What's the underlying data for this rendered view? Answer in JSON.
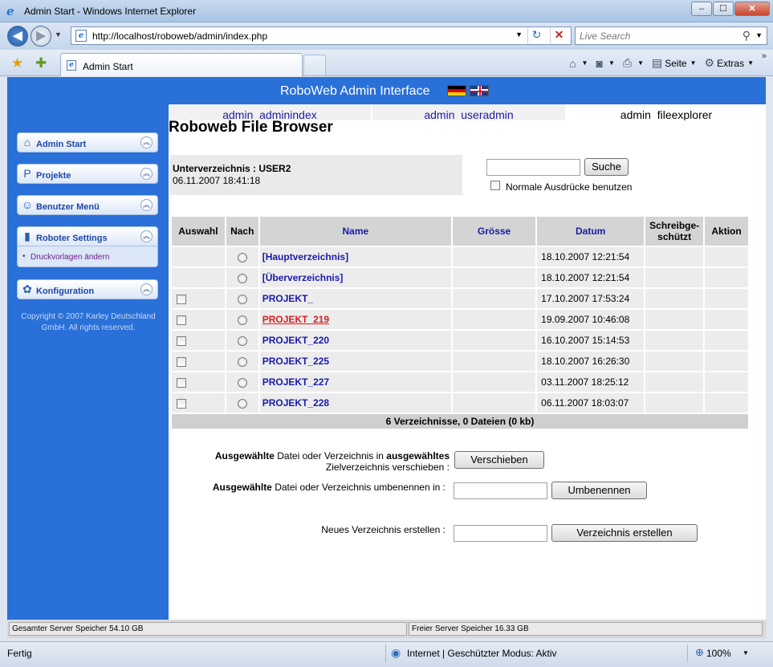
{
  "window": {
    "title": "Admin Start - Windows Internet Explorer",
    "min": "–",
    "max": "☐",
    "close": "✕"
  },
  "address_bar": {
    "url": "http://localhost/roboweb/admin/index.php",
    "search_placeholder": "Live Search"
  },
  "tabbar": {
    "tab_label": "Admin Start",
    "cmd_home": "⌂",
    "cmd_feeds": "◙",
    "cmd_print": "⎙",
    "cmd_page_label": "Seite",
    "cmd_tools_label": "Extras"
  },
  "header": {
    "title": "RoboWeb Admin Interface"
  },
  "sidebar": {
    "items": [
      {
        "label": "Admin Start",
        "icon": "⌂"
      },
      {
        "label": "Projekte",
        "icon": "P"
      },
      {
        "label": "Benutzer Menü",
        "icon": "☺"
      },
      {
        "label": "Roboter Settings",
        "icon": "▮"
      },
      {
        "label": "Konfiguration",
        "icon": "✿"
      }
    ],
    "sub_item": "Druckvorlagen ändern",
    "copyright": "Copyright © 2007 Karley Deutschland GmbH. All rights reserved."
  },
  "nav_tabs": [
    {
      "label": "admin_adminindex"
    },
    {
      "label": "admin_useradmin"
    },
    {
      "label": "admin_fileexplorer"
    }
  ],
  "page_title": "Roboweb File Browser",
  "directory": {
    "label": "Unterverzeichnis : USER2",
    "date": "06.11.2007 18:41:18"
  },
  "search": {
    "button": "Suche",
    "regex_label": "Normale Ausdrücke benutzen"
  },
  "table": {
    "headers": {
      "select": "Auswahl",
      "target": "Nach",
      "name": "Name",
      "size": "Grösse",
      "date": "Datum",
      "readonly": "Schreibge-schützt",
      "action": "Aktion"
    },
    "rows": [
      {
        "name": "[Hauptverzeichnis]",
        "size": "",
        "date": "18.10.2007 12:21:54"
      },
      {
        "name": "[Überverzeichnis]",
        "size": "",
        "date": "18.10.2007 12:21:54"
      },
      {
        "name": "PROJEKT_",
        "size": "",
        "date": "17.10.2007 17:53:24"
      },
      {
        "name": "PROJEKT_219",
        "size": "",
        "date": "19.09.2007 10:46:08"
      },
      {
        "name": "PROJEKT_220",
        "size": "",
        "date": "16.10.2007 15:14:53"
      },
      {
        "name": "PROJEKT_225",
        "size": "",
        "date": "18.10.2007 16:26:30"
      },
      {
        "name": "PROJEKT_227",
        "size": "",
        "date": "03.11.2007 18:25:12"
      },
      {
        "name": "PROJEKT_228",
        "size": "",
        "date": "06.11.2007 18:03:07"
      }
    ],
    "summary": "6 Verzeichnisse, 0 Dateien (0 kb)"
  },
  "operations": {
    "move_label_b1": "Ausgewählte",
    "move_label_t1": " Datei oder Verzeichnis in ",
    "move_label_b2": "ausgewähltes",
    "move_label_t2": "Zielverzeichnis verschieben :",
    "move_button": "Verschieben",
    "rename_label_b": "Ausgewählte",
    "rename_label_t": " Datei oder Verzeichnis umbenennen in :",
    "rename_button": "Umbenennen",
    "mkdir_label": "Neues Verzeichnis erstellen :",
    "mkdir_button": "Verzeichnis erstellen"
  },
  "storage": {
    "total": "Gesamter Server Speicher 54.10 GB",
    "free": "Freier Server Speicher 16.33 GB"
  },
  "statusbar": {
    "status": "Fertig",
    "zone": "Internet | Geschützter Modus: Aktiv",
    "zoom": "100%"
  },
  "colors": {
    "brand_blue": "#2970d8",
    "link": "#1a1aaa",
    "hover_link": "#d61f1f"
  }
}
